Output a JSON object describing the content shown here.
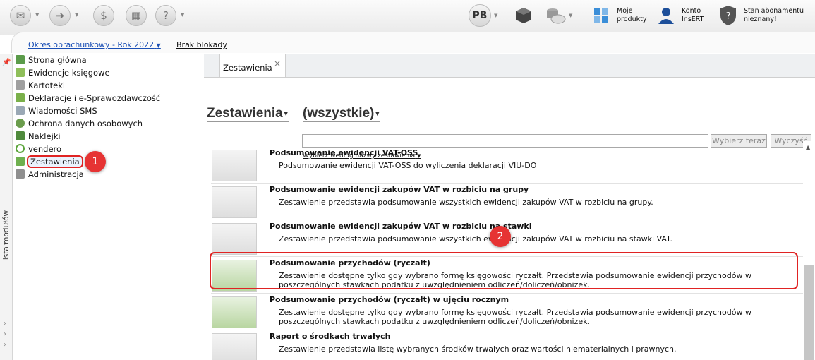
{
  "toolbar": {
    "left_icons": [
      "mail-icon",
      "send-icon",
      "accounting-icon",
      "box-icon",
      "help-icon"
    ],
    "profile_initials": "PB",
    "moje_produkty": "Moje\nprodukty",
    "konto_insert": "Konto\nInsERT",
    "stan_abonamentu": "Stan abonamentu\nnieznany!"
  },
  "period": {
    "link_label": "Okres obrachunkowy - Rok 2022",
    "block_label": "Brak blokady"
  },
  "nav": {
    "items": [
      {
        "label": "Strona główna",
        "icon": "home-icon"
      },
      {
        "label": "Ewidencje księgowe",
        "icon": "ledger-icon"
      },
      {
        "label": "Kartoteki",
        "icon": "files-icon"
      },
      {
        "label": "Deklaracje i e-Sprawozdawczość",
        "icon": "declaration-icon"
      },
      {
        "label": "Wiadomości SMS",
        "icon": "sms-icon"
      },
      {
        "label": "Ochrona danych osobowych",
        "icon": "shield-icon"
      },
      {
        "label": "Naklejki",
        "icon": "sticker-icon"
      },
      {
        "label": "vendero",
        "icon": "vendero-icon"
      },
      {
        "label": "Zestawienia",
        "icon": "reports-icon"
      },
      {
        "label": "Administracja",
        "icon": "admin-icon"
      }
    ],
    "modules_label": "Lista modułów"
  },
  "tab": {
    "label": "Zestawienia",
    "close": "×"
  },
  "header": {
    "title": "Zestawienia",
    "filter": "(wszystkie)"
  },
  "search": {
    "button_select": "Wybierz teraz",
    "button_clear": "Wyczyść",
    "hint": "Wybierz według nazwy zestawienia"
  },
  "reports": [
    {
      "title": "Podsumowanie ewidencji VAT-OSS",
      "desc": "Podsumowanie ewidencji VAT-OSS do wyliczenia deklaracji VIU-DO"
    },
    {
      "title": "Podsumowanie ewidencji zakupów VAT w rozbiciu na grupy",
      "desc": "Zestawienie przedstawia podsumowanie wszystkich ewidencji zakupów VAT w rozbiciu na grupy."
    },
    {
      "title": "Podsumowanie ewidencji zakupów VAT w rozbiciu na stawki",
      "desc": "Zestawienie przedstawia podsumowanie wszystkich ewidencji zakupów VAT w rozbiciu na stawki VAT."
    },
    {
      "title": "Podsumowanie przychodów (ryczałt)",
      "desc": "Zestawienie dostępne tylko gdy wybrano formę księgowości ryczałt. Przedstawia podsumowanie ewidencji przychodów w poszczególnych stawkach podatku z uwzględnieniem odliczeń/doliczeń/obniżek."
    },
    {
      "title": "Podsumowanie przychodów (ryczałt) w ujęciu rocznym",
      "desc": "Zestawienie dostępne tylko gdy wybrano formę księgowości ryczałt. Przedstawia podsumowanie ewidencji przychodów w poszczególnych stawkach podatku z uwzględnieniem odliczeń/doliczeń/obniżek."
    },
    {
      "title": "Raport o środkach trwałych",
      "desc": "Zestawienie przedstawia listę wybranych środków trwałych oraz wartości niematerialnych i prawnych."
    }
  ],
  "badges": {
    "one": "1",
    "two": "2"
  },
  "colors": {
    "accent_red": "#e02323",
    "link_blue": "#1a4fb5",
    "icon_green": "#4aa64a"
  }
}
